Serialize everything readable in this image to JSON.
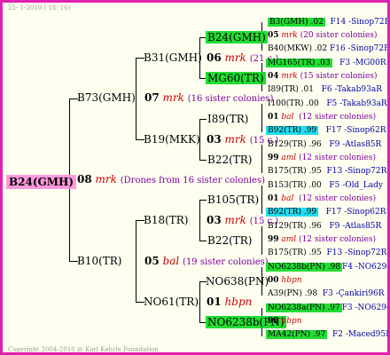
{
  "header": {
    "date": "25-  1-2010  ( 18: 16)"
  },
  "footer": {
    "copyright": "Copyright 2004-2010 @ Karl Kehrle Foundation"
  },
  "root": {
    "name": "B24(GMH)",
    "gen": "08",
    "mark": "mrk",
    "info": "(Drones from 16 sister colonies)"
  },
  "g1_top": {
    "name": "B73(GMH)",
    "gen": "07",
    "mark": "mrk",
    "info": "(16 sister colonies)"
  },
  "g1_bot": {
    "name": "B10(TR)",
    "gen": "05",
    "mark": "bal",
    "info": "(19 sister colonies)"
  },
  "g2_b31": {
    "name": "B31(GMH)",
    "gen": "06",
    "mark": "mrk",
    "info": "(21 c.)"
  },
  "g2_b19": {
    "name": "B19(MKK)",
    "gen": "03",
    "mark": "mrk",
    "info": "(15 c.)"
  },
  "g2_b18": {
    "name": "B18(TR)",
    "gen": "03",
    "mark": "mrk",
    "info": "(15 c.)"
  },
  "g2_no61": {
    "name": "NO61(TR)",
    "gen": "01",
    "mark": "hbpn"
  },
  "g3_b24": {
    "name": "B24(GMH)"
  },
  "g3_mg60": {
    "name": "MG60(TR)"
  },
  "g3_i89": {
    "name": "I89(TR)"
  },
  "g3_b22a": {
    "name": "B22(TR)"
  },
  "g3_b105": {
    "name": "B105(TR)"
  },
  "g3_b22b": {
    "name": "B22(TR)"
  },
  "g3_no638": {
    "name": "NO638(PN)",
    "gen": "00",
    "mark": "hbpn"
  },
  "g3_no6238b": {
    "name": "NO6238b(PN)"
  },
  "g4": [
    {
      "name": "B3(GMH) .02",
      "loc": "F14 -Sinop72R"
    },
    {
      "gen": "05",
      "mark": "mrk",
      "info": "(20 sister colonies)"
    },
    {
      "name": "B40(MKW) .02",
      "loc": "F16 -Sinop72R"
    },
    {
      "name": "MG165(TR) .03",
      "loc": "F3 -MG00R"
    },
    {
      "gen": "04",
      "mark": "mrk",
      "info": "(15 sister colonies)"
    },
    {
      "name": "I89(TR) .01",
      "loc": "F6 -Takab93aR"
    },
    {
      "name": "I100(TR) .00",
      "loc": "F5 -Takab93aR"
    },
    {
      "gen": "01",
      "mark": "bal",
      "info": "(12 sister colonies)"
    },
    {
      "name": "B92(TR) .99",
      "loc": "F17 -Sinop62R"
    },
    {
      "name": "B129(TR) .96",
      "loc": "F9 -Atlas85R"
    },
    {
      "gen": "99",
      "mark": "aml",
      "info": "(12 sister colonies)"
    },
    {
      "name": "B175(TR) .95",
      "loc": "F13 -Sinop72R"
    },
    {
      "name": "B153(TR) .00",
      "loc": "F5 -Old_Lady"
    },
    {
      "gen": "01",
      "mark": "bal",
      "info": "(12 sister colonies)"
    },
    {
      "name": "B92(TR) .99",
      "loc": "F17 -Sinop62R"
    },
    {
      "name": "B129(TR) .96",
      "loc": "F9 -Atlas85R"
    },
    {
      "gen": "99",
      "mark": "aml",
      "info": "(12 sister colonies)"
    },
    {
      "name": "B175(TR) .95",
      "loc": "F13 -Sinop72R"
    },
    {
      "name": "NO6238b(PN) .98",
      "loc": "F4 -NO6294R"
    },
    {
      "gen": "00",
      "mark": "hbpn"
    },
    {
      "name": "A39(PN) .98",
      "loc": "F3 -Çankiri96R"
    },
    {
      "name": "NO6238a(PN) .97",
      "loc": "F3 -NO6294R"
    },
    {
      "gen": "98",
      "mark": "hbpn"
    },
    {
      "name": "MA42(PN) .97",
      "loc": "F2 -Maced95R"
    }
  ]
}
